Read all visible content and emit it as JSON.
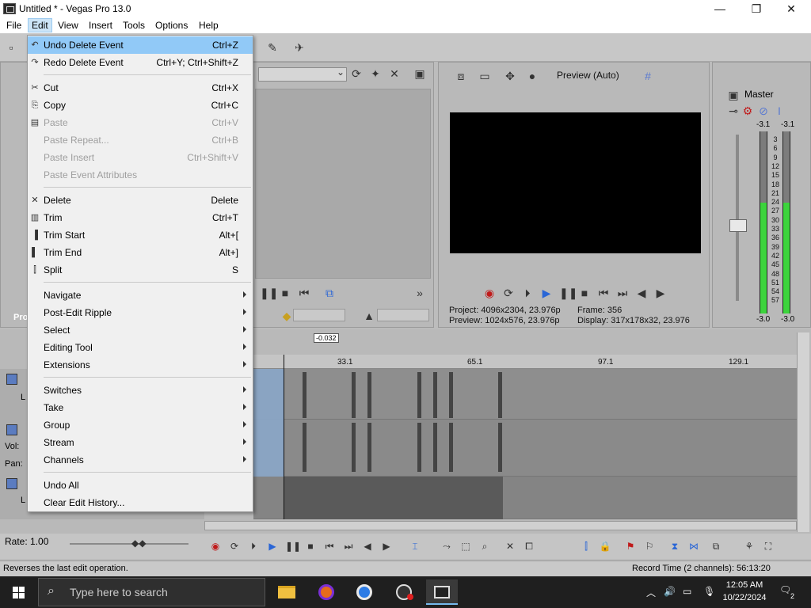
{
  "window": {
    "title": "Untitled * - Vegas Pro 13.0",
    "minimize": "—",
    "maximize": "❐",
    "close": "✕"
  },
  "menubar": {
    "items": [
      "File",
      "Edit",
      "View",
      "Insert",
      "Tools",
      "Options",
      "Help"
    ]
  },
  "edit_menu": {
    "items": [
      {
        "label": "Undo Delete Event",
        "shortcut": "Ctrl+Z",
        "state": "highlight"
      },
      {
        "label": "Redo Delete Event",
        "shortcut": "Ctrl+Y; Ctrl+Shift+Z",
        "state": "enabled"
      },
      {
        "label": "Cut",
        "shortcut": "Ctrl+X",
        "state": "enabled"
      },
      {
        "label": "Copy",
        "shortcut": "Ctrl+C",
        "state": "enabled"
      },
      {
        "label": "Paste",
        "shortcut": "Ctrl+V",
        "state": "disabled"
      },
      {
        "label": "Paste Repeat...",
        "shortcut": "Ctrl+B",
        "state": "disabled"
      },
      {
        "label": "Paste Insert",
        "shortcut": "Ctrl+Shift+V",
        "state": "disabled"
      },
      {
        "label": "Paste Event Attributes",
        "shortcut": "",
        "state": "disabled"
      },
      {
        "label": "Delete",
        "shortcut": "Delete",
        "state": "enabled"
      },
      {
        "label": "Trim",
        "shortcut": "Ctrl+T",
        "state": "enabled"
      },
      {
        "label": "Trim Start",
        "shortcut": "Alt+[",
        "state": "enabled"
      },
      {
        "label": "Trim End",
        "shortcut": "Alt+]",
        "state": "enabled"
      },
      {
        "label": "Split",
        "shortcut": "S",
        "state": "enabled"
      },
      {
        "label": "Navigate",
        "shortcut": "",
        "state": "submenu"
      },
      {
        "label": "Post-Edit Ripple",
        "shortcut": "",
        "state": "submenu"
      },
      {
        "label": "Select",
        "shortcut": "",
        "state": "submenu"
      },
      {
        "label": "Editing Tool",
        "shortcut": "",
        "state": "submenu"
      },
      {
        "label": "Extensions",
        "shortcut": "",
        "state": "submenu"
      },
      {
        "label": "Switches",
        "shortcut": "",
        "state": "submenu"
      },
      {
        "label": "Take",
        "shortcut": "",
        "state": "submenu"
      },
      {
        "label": "Group",
        "shortcut": "",
        "state": "submenu"
      },
      {
        "label": "Stream",
        "shortcut": "",
        "state": "submenu"
      },
      {
        "label": "Channels",
        "shortcut": "",
        "state": "submenu"
      },
      {
        "label": "Undo All",
        "shortcut": "",
        "state": "enabled"
      },
      {
        "label": "Clear Edit History...",
        "shortcut": "",
        "state": "enabled"
      }
    ]
  },
  "preview": {
    "mode": "Preview (Auto)",
    "project_label": "Project:",
    "project_value": "4096x2304, 23.976p",
    "preview_label": "Preview:",
    "preview_value": "1024x576, 23.976p",
    "frame_label": "Frame:",
    "frame_value": "356",
    "display_label": "Display:",
    "display_value": "317x178x32, 23.976"
  },
  "master": {
    "label": "Master",
    "left_peak": "-3.1",
    "right_peak": "-3.1",
    "left_bottom": "-3.0",
    "right_bottom": "-3.0",
    "scale": [
      "3",
      "6",
      "9",
      "12",
      "15",
      "18",
      "21",
      "24",
      "27",
      "30",
      "33",
      "36",
      "39",
      "42",
      "45",
      "48",
      "51",
      "54",
      "57"
    ]
  },
  "timeline": {
    "cursor_tag": "-0.032",
    "ruler": [
      "33.1",
      "65.1",
      "97.1",
      "129.1"
    ],
    "vol_label": "Vol:",
    "pan_label": "Pan:",
    "left_panel_tab": "Pro",
    "track_letter": "L"
  },
  "transport": {
    "rate": "Rate: 1.00"
  },
  "status": {
    "left": "Reverses the last edit operation.",
    "right": "Record Time (2 channels): 56:13:20"
  },
  "taskbar": {
    "search_placeholder": "Type here to search",
    "time": "12:05 AM",
    "date": "10/22/2024",
    "notifications": "2"
  }
}
